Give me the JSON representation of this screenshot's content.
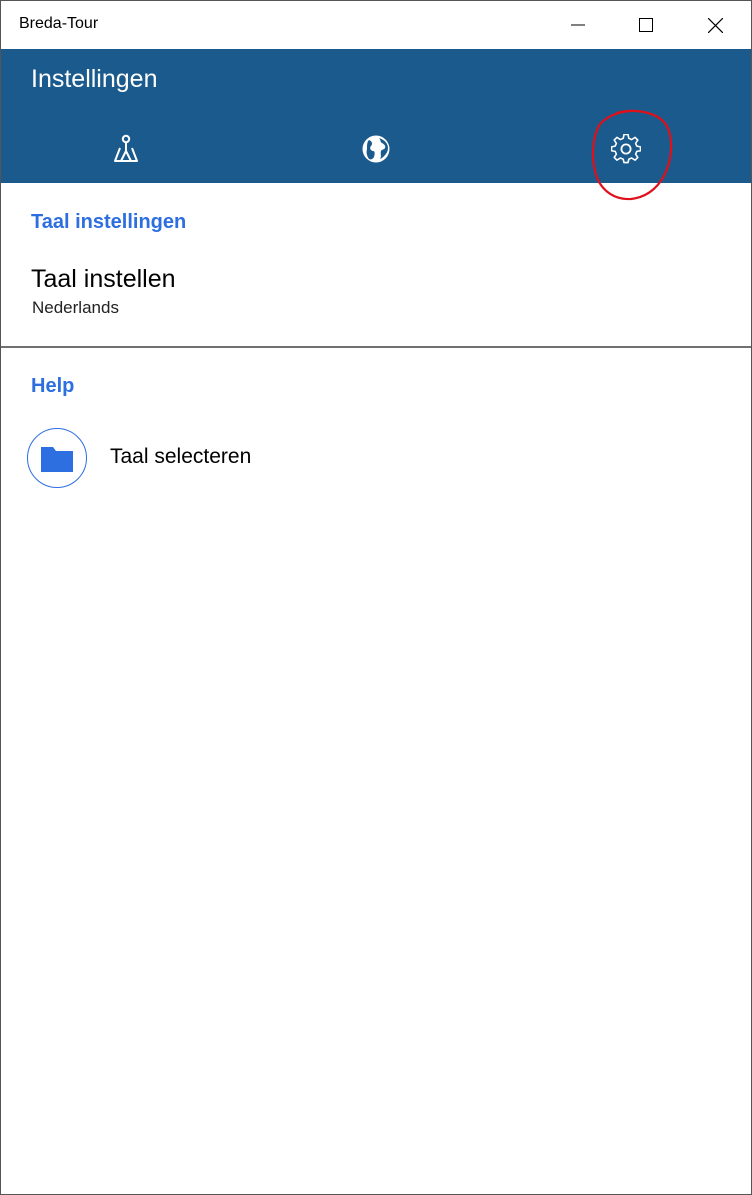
{
  "window": {
    "title": "Breda-Tour"
  },
  "header": {
    "title": "Instellingen",
    "tabs": [
      {
        "icon": "map-icon",
        "selected": false
      },
      {
        "icon": "globe-icon",
        "selected": false
      },
      {
        "icon": "gear-icon",
        "selected": true
      }
    ]
  },
  "language_section": {
    "heading": "Taal instellingen",
    "setting_label": "Taal instellen",
    "setting_value": "Nederlands"
  },
  "help_section": {
    "heading": "Help",
    "item_label": "Taal selecteren",
    "item_icon": "folder-icon"
  },
  "colors": {
    "header_bg": "#1a5a8c",
    "accent": "#2d6fe0",
    "annotation": "#e0101a"
  }
}
